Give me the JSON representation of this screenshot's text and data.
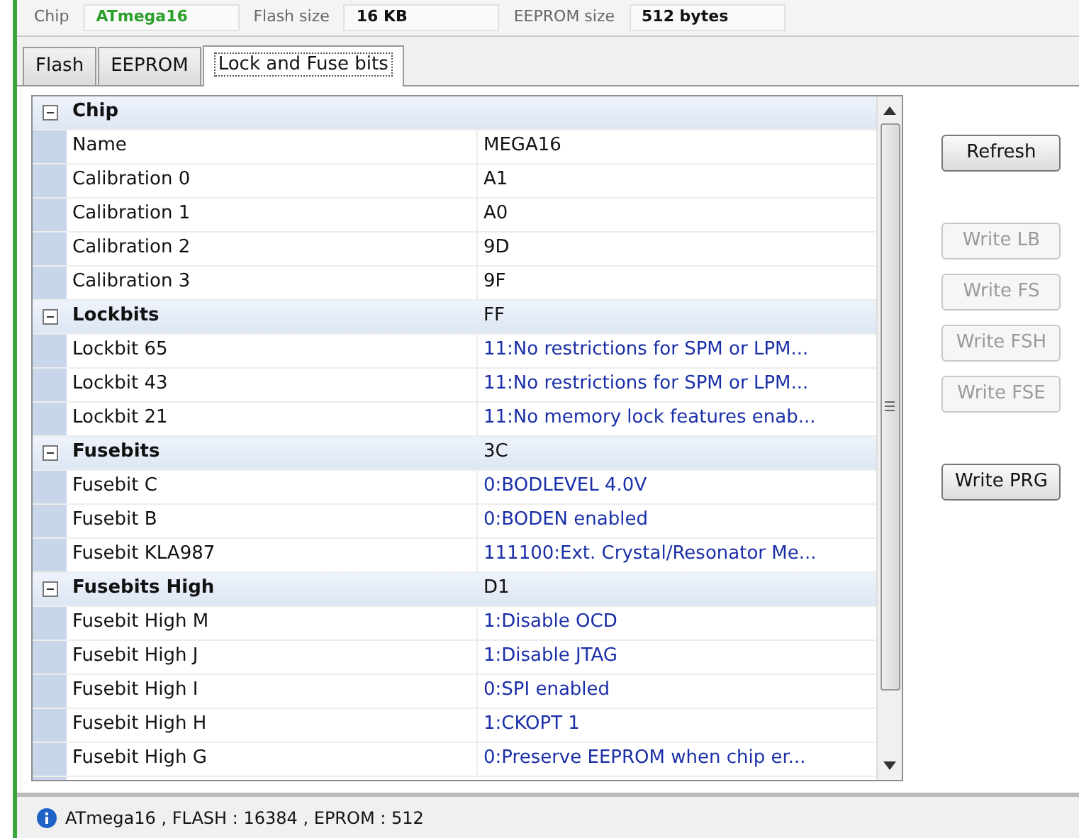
{
  "chip_info": [
    {
      "label": "Chip",
      "value": "ATmega16"
    },
    {
      "label": "Flash size",
      "value": "16 KB"
    },
    {
      "label": "EEPROM size",
      "value": "512 bytes"
    }
  ],
  "tabs": [
    {
      "label": "Flash",
      "selected": false
    },
    {
      "label": "EEPROM",
      "selected": false
    },
    {
      "label": "Lock and Fuse bits",
      "selected": true
    }
  ],
  "categories": [
    {
      "name": "Chip",
      "expanded": true,
      "children": [
        {
          "name": "Name",
          "value": "MEGA16",
          "kind": "info"
        },
        {
          "name": "Calibration 0",
          "value": "A1",
          "kind": "info"
        },
        {
          "name": "Calibration 1",
          "value": "A0",
          "kind": "info"
        },
        {
          "name": "Calibration 2",
          "value": "9D",
          "kind": "info"
        },
        {
          "name": "Calibration 3",
          "value": "9F",
          "kind": "info"
        }
      ]
    },
    {
      "name": "Lockbits",
      "value": "FF",
      "expanded": true,
      "children": [
        {
          "name": "Lockbit 65",
          "value": "11:No restrictions for SPM or LPM...",
          "kind": "option"
        },
        {
          "name": "Lockbit 43",
          "value": "11:No restrictions for SPM or LPM...",
          "kind": "option"
        },
        {
          "name": "Lockbit 21",
          "value": "11:No memory lock features enab...",
          "kind": "option"
        }
      ]
    },
    {
      "name": "Fusebits",
      "value": "3C",
      "expanded": true,
      "children": [
        {
          "name": "Fusebit C",
          "value": "0:BODLEVEL 4.0V",
          "kind": "option"
        },
        {
          "name": "Fusebit B",
          "value": "0:BODEN enabled",
          "kind": "option"
        },
        {
          "name": "Fusebit KLA987",
          "value": "111100:Ext. Crystal/Resonator Me...",
          "kind": "option"
        }
      ]
    },
    {
      "name": "Fusebits High",
      "value": "D1",
      "expanded": true,
      "children": [
        {
          "name": "Fusebit High M",
          "value": "1:Disable OCD",
          "kind": "option"
        },
        {
          "name": "Fusebit High J",
          "value": "1:Disable JTAG",
          "kind": "option"
        },
        {
          "name": "Fusebit High I",
          "value": "0:SPI enabled",
          "kind": "option"
        },
        {
          "name": "Fusebit High H",
          "value": "1:CKOPT 1",
          "kind": "option"
        },
        {
          "name": "Fusebit High G",
          "value": "0:Preserve EEPROM when chip er...",
          "kind": "option"
        }
      ]
    }
  ],
  "buttons": [
    {
      "label": "Refresh",
      "disabled": false
    },
    {
      "label": "Write LB",
      "disabled": true
    },
    {
      "label": "Write FS",
      "disabled": true
    },
    {
      "label": "Write FSH",
      "disabled": true
    },
    {
      "label": "Write FSE",
      "disabled": true
    },
    {
      "label": "Write PRG",
      "disabled": false
    }
  ],
  "status_bar": {
    "text": "ATmega16 , FLASH : 16384 , EPROM : 512"
  }
}
